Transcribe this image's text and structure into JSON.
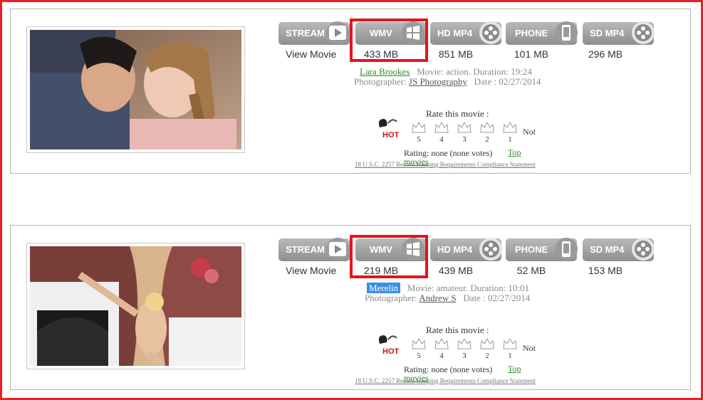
{
  "colors": {
    "highlight": "#e3151e",
    "link_green": "#2a8a2a",
    "button_grey": "#a3a3a3",
    "selection_blue": "#3a8ee6"
  },
  "cards": [
    {
      "buttons": [
        {
          "label": "STREAM",
          "icon": "play-icon",
          "caption": "View Movie"
        },
        {
          "label": "WMV",
          "icon": "windows-icon",
          "caption": "433 MB"
        },
        {
          "label": "HD MP4",
          "icon": "film-reel-icon",
          "caption": "851 MB"
        },
        {
          "label": "PHONE",
          "icon": "phone-icon",
          "caption": "101 MB"
        },
        {
          "label": "SD MP4",
          "icon": "film-reel-icon",
          "caption": "296 MB"
        }
      ],
      "performer": "Lara Brookes",
      "movie_info": "Movie: action. Duration: 19:24",
      "photographer_label": "Photographer:",
      "photographer": "JS Photography",
      "date": "Date : 02/27/2014",
      "rate_title": "Rate this movie :",
      "rate_values": [
        "5",
        "4",
        "3",
        "2",
        "1"
      ],
      "not_label": "Not",
      "rating_text": "Rating: none   (none votes)",
      "top_movies": "Top movies",
      "legal": "18 U.S.C. 2257 Record-Keeping Requirements Compliance Statement",
      "hot_label": "HOT"
    },
    {
      "buttons": [
        {
          "label": "STREAM",
          "icon": "play-icon",
          "caption": "View Movie"
        },
        {
          "label": "WMV",
          "icon": "windows-icon",
          "caption": "219 MB"
        },
        {
          "label": "HD MP4",
          "icon": "film-reel-icon",
          "caption": "439 MB"
        },
        {
          "label": "PHONE",
          "icon": "phone-icon",
          "caption": "52 MB"
        },
        {
          "label": "SD MP4",
          "icon": "film-reel-icon",
          "caption": "153 MB"
        }
      ],
      "performer": "Merelin",
      "movie_info": "Movie: amateur. Duration: 10:01",
      "photographer_label": "Photographer:",
      "photographer": "Andrew S",
      "date": "Date : 02/27/2014",
      "rate_title": "Rate this movie :",
      "rate_values": [
        "5",
        "4",
        "3",
        "2",
        "1"
      ],
      "not_label": "Not",
      "rating_text": "Rating: none   (none votes)",
      "top_movies": "Top movies",
      "legal": "18 U.S.C. 2257 Record-Keeping Requirements Compliance Statement",
      "hot_label": "HOT"
    }
  ]
}
